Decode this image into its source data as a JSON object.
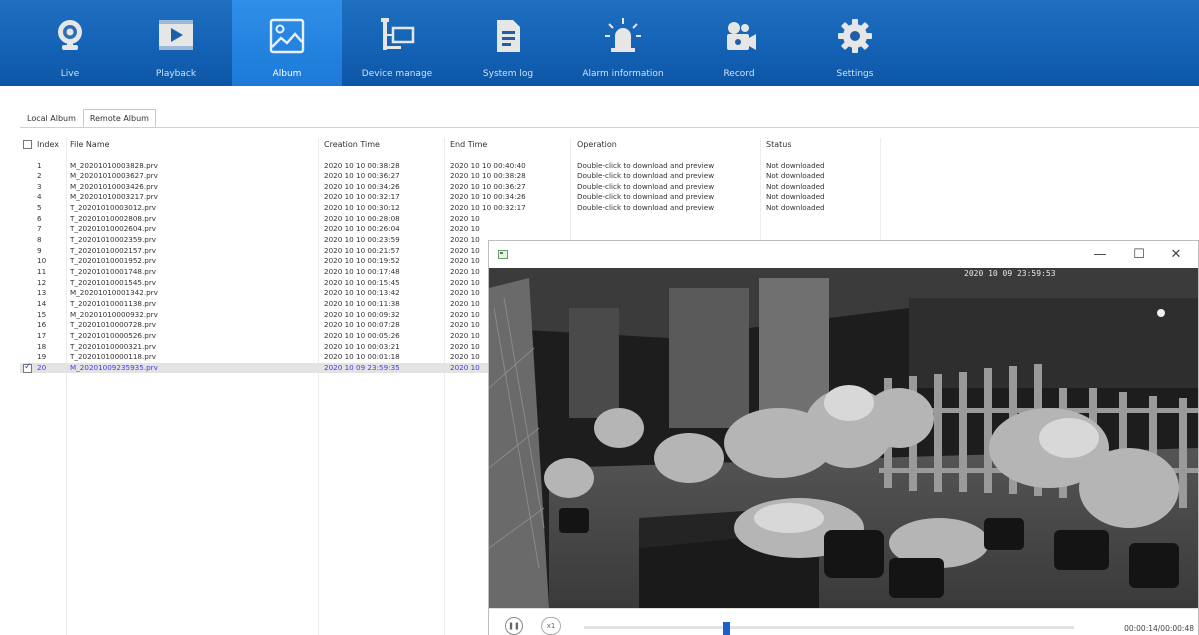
{
  "nav": {
    "items": [
      {
        "id": "live",
        "label": "Live",
        "icon": "webcam-icon"
      },
      {
        "id": "playback",
        "label": "Playback",
        "icon": "film-play-icon"
      },
      {
        "id": "album",
        "label": "Album",
        "icon": "image-icon",
        "active": true
      },
      {
        "id": "device",
        "label": "Device manage",
        "icon": "device-network-icon"
      },
      {
        "id": "syslog",
        "label": "System log",
        "icon": "document-icon"
      },
      {
        "id": "alarm",
        "label": "Alarm information",
        "icon": "alarm-light-icon"
      },
      {
        "id": "record",
        "label": "Record",
        "icon": "record-camera-icon"
      },
      {
        "id": "settings",
        "label": "Settings",
        "icon": "gear-icon"
      }
    ]
  },
  "tabs": [
    {
      "label": "Local Album",
      "active": false
    },
    {
      "label": "Remote Album",
      "active": true
    }
  ],
  "table": {
    "headers": {
      "index": "Index",
      "file_name": "File Name",
      "creation_time": "Creation Time",
      "end_time": "End Time",
      "operation": "Operation",
      "status": "Status"
    },
    "rows": [
      {
        "index": "1",
        "file": "M_20201010003828.prv",
        "created": "2020 10 10 00:38:28",
        "end": "2020 10 10 00:40:40",
        "op": "Double-click to download and preview",
        "status": "Not downloaded"
      },
      {
        "index": "2",
        "file": "M_20201010003627.prv",
        "created": "2020 10 10 00:36:27",
        "end": "2020 10 10 00:38:28",
        "op": "Double-click to download and preview",
        "status": "Not downloaded"
      },
      {
        "index": "3",
        "file": "M_20201010003426.prv",
        "created": "2020 10 10 00:34:26",
        "end": "2020 10 10 00:36:27",
        "op": "Double-click to download and preview",
        "status": "Not downloaded"
      },
      {
        "index": "4",
        "file": "M_20201010003217.prv",
        "created": "2020 10 10 00:32:17",
        "end": "2020 10 10 00:34:26",
        "op": "Double-click to download and preview",
        "status": "Not downloaded"
      },
      {
        "index": "5",
        "file": "T_20201010003012.prv",
        "created": "2020 10 10 00:30:12",
        "end": "2020 10 10 00:32:17",
        "op": "Double-click to download and preview",
        "status": "Not downloaded"
      },
      {
        "index": "6",
        "file": "T_20201010002808.prv",
        "created": "2020 10 10 00:28:08",
        "end": "2020 10",
        "op": "",
        "status": ""
      },
      {
        "index": "7",
        "file": "T_20201010002604.prv",
        "created": "2020 10 10 00:26:04",
        "end": "2020 10",
        "op": "",
        "status": ""
      },
      {
        "index": "8",
        "file": "T_20201010002359.prv",
        "created": "2020 10 10 00:23:59",
        "end": "2020 10",
        "op": "",
        "status": ""
      },
      {
        "index": "9",
        "file": "T_20201010002157.prv",
        "created": "2020 10 10 00:21:57",
        "end": "2020 10",
        "op": "",
        "status": ""
      },
      {
        "index": "10",
        "file": "T_20201010001952.prv",
        "created": "2020 10 10 00:19:52",
        "end": "2020 10",
        "op": "",
        "status": ""
      },
      {
        "index": "11",
        "file": "T_20201010001748.prv",
        "created": "2020 10 10 00:17:48",
        "end": "2020 10",
        "op": "",
        "status": ""
      },
      {
        "index": "12",
        "file": "T_20201010001545.prv",
        "created": "2020 10 10 00:15:45",
        "end": "2020 10",
        "op": "",
        "status": ""
      },
      {
        "index": "13",
        "file": "M_20201010001342.prv",
        "created": "2020 10 10 00:13:42",
        "end": "2020 10",
        "op": "",
        "status": ""
      },
      {
        "index": "14",
        "file": "T_20201010001138.prv",
        "created": "2020 10 10 00:11:38",
        "end": "2020 10",
        "op": "",
        "status": ""
      },
      {
        "index": "15",
        "file": "M_20201010000932.prv",
        "created": "2020 10 10 00:09:32",
        "end": "2020 10",
        "op": "",
        "status": ""
      },
      {
        "index": "16",
        "file": "T_20201010000728.prv",
        "created": "2020 10 10 00:07:28",
        "end": "2020 10",
        "op": "",
        "status": ""
      },
      {
        "index": "17",
        "file": "T_20201010000526.prv",
        "created": "2020 10 10 00:05:26",
        "end": "2020 10",
        "op": "",
        "status": ""
      },
      {
        "index": "18",
        "file": "T_20201010000321.prv",
        "created": "2020 10 10 00:03:21",
        "end": "2020 10",
        "op": "",
        "status": ""
      },
      {
        "index": "19",
        "file": "T_20201010000118.prv",
        "created": "2020 10 10 00:01:18",
        "end": "2020 10",
        "op": "",
        "status": ""
      },
      {
        "index": "20",
        "file": "M_20201009235935.prv",
        "created": "2020 10 09 23:59:35",
        "end": "2020 10",
        "op": "",
        "status": "",
        "selected": true
      }
    ]
  },
  "preview": {
    "osd_timestamp": "2020 10 09 23:59:53",
    "time_display": "00:00:14/00:00:48",
    "speed_label": "x1",
    "progress_fraction": 0.29,
    "controls": {
      "minimize": "—",
      "maximize": "☐",
      "close": "✕"
    }
  },
  "colors": {
    "toolbar": "#1462b5",
    "active_nav": "#2f8fe8",
    "selected_row_text": "#3f3ff0",
    "progress_thumb": "#1d5fd0"
  }
}
